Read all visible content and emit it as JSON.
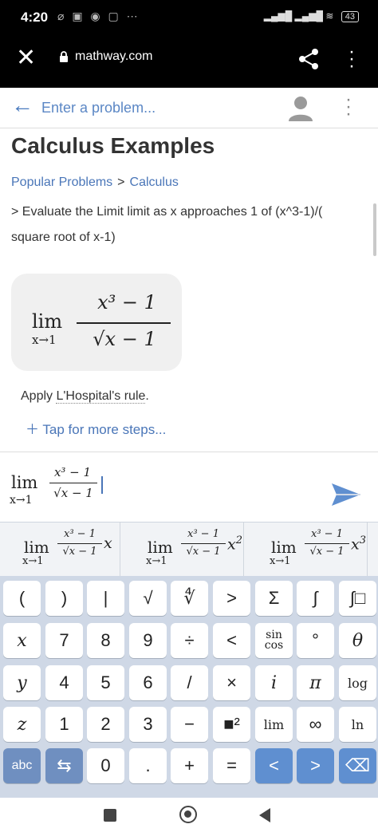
{
  "status": {
    "time": "4:20",
    "battery": "43"
  },
  "browser": {
    "url": "mathway.com"
  },
  "search": {
    "placeholder": "Enter a problem..."
  },
  "page": {
    "title": "Calculus Examples",
    "breadcrumb": [
      "Popular Problems",
      "Calculus"
    ],
    "breadcrumb_sep": ">",
    "problem": "> Evaluate the Limit limit as x approaches 1 of (x^3-1)/( square root of x-1)",
    "step_prefix": "Apply ",
    "step_link": "L'Hospital's rule",
    "step_suffix": ".",
    "more_steps": "Tap for more steps..."
  },
  "math": {
    "lim": "lim",
    "sub": "x→1",
    "numerator": "x³ − 1",
    "denominator": "√x − 1"
  },
  "suggestions": [
    {
      "factor": "x",
      "power": ""
    },
    {
      "factor": "x",
      "power": "2"
    },
    {
      "factor": "x",
      "power": "3"
    }
  ],
  "keyboard": {
    "rows": [
      [
        "(",
        ")",
        "|",
        "√",
        "∜",
        ">",
        "Σ",
        "∫",
        "∫□"
      ],
      [
        "x",
        "7",
        "8",
        "9",
        "÷",
        "<",
        "sin cos",
        "°",
        "θ"
      ],
      [
        "y",
        "4",
        "5",
        "6",
        "/",
        "×",
        "i",
        "π",
        "log"
      ],
      [
        "z",
        "1",
        "2",
        "3",
        "−",
        "■²",
        "lim",
        "∞",
        "ln"
      ],
      [
        "abc",
        "⇆",
        "0",
        ".",
        "+",
        "=",
        "<",
        ">",
        "⌫"
      ]
    ]
  },
  "colors": {
    "accent": "#4a76b8",
    "keyboard_bg": "#cfd8e6",
    "blue_key": "#5f8fd0"
  }
}
